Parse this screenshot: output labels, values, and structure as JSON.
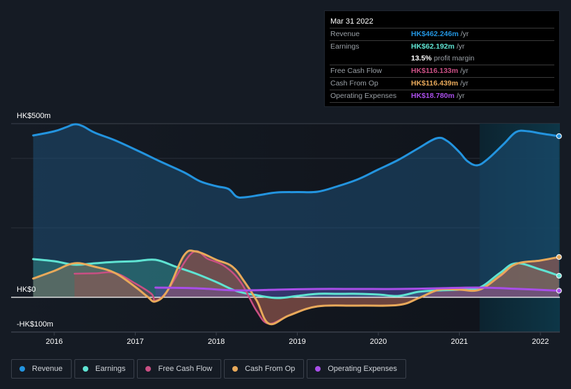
{
  "chart_data": {
    "type": "area",
    "title": "",
    "currency_prefix": "HK$",
    "x_unit": "year",
    "xlim": [
      2015.74,
      2022.25
    ],
    "ylim": [
      -100,
      500
    ],
    "y_ticks": [
      {
        "value": 500,
        "label": "HK$500m"
      },
      {
        "value": 0,
        "label": "HK$0"
      },
      {
        "value": -100,
        "label": "-HK$100m"
      }
    ],
    "gridlines": [
      500,
      400,
      200
    ],
    "x_ticks": [
      {
        "value": 2016,
        "label": "2016"
      },
      {
        "value": 2017,
        "label": "2017"
      },
      {
        "value": 2018,
        "label": "2018"
      },
      {
        "value": 2019,
        "label": "2019"
      },
      {
        "value": 2020,
        "label": "2020"
      },
      {
        "value": 2021,
        "label": "2021"
      },
      {
        "value": 2022,
        "label": "2022"
      }
    ],
    "highlight_range": [
      2021.25,
      2022.25
    ],
    "series": [
      {
        "name": "Revenue",
        "color": "#2394df",
        "points": [
          [
            2015.74,
            466
          ],
          [
            2016.0,
            478
          ],
          [
            2016.15,
            490
          ],
          [
            2016.25,
            498
          ],
          [
            2016.35,
            493
          ],
          [
            2016.5,
            474
          ],
          [
            2016.75,
            452
          ],
          [
            2017.05,
            420
          ],
          [
            2017.3,
            392
          ],
          [
            2017.6,
            360
          ],
          [
            2017.8,
            334
          ],
          [
            2018.0,
            320
          ],
          [
            2018.15,
            312
          ],
          [
            2018.25,
            290
          ],
          [
            2018.35,
            288
          ],
          [
            2018.55,
            295
          ],
          [
            2018.75,
            302
          ],
          [
            2019.0,
            303
          ],
          [
            2019.25,
            304
          ],
          [
            2019.5,
            320
          ],
          [
            2019.75,
            340
          ],
          [
            2020.0,
            368
          ],
          [
            2020.25,
            396
          ],
          [
            2020.5,
            430
          ],
          [
            2020.72,
            458
          ],
          [
            2020.85,
            450
          ],
          [
            2021.0,
            418
          ],
          [
            2021.1,
            392
          ],
          [
            2021.22,
            380
          ],
          [
            2021.35,
            398
          ],
          [
            2021.55,
            442
          ],
          [
            2021.7,
            476
          ],
          [
            2021.85,
            478
          ],
          [
            2022.0,
            472
          ],
          [
            2022.23,
            464
          ]
        ]
      },
      {
        "name": "Earnings",
        "color": "#5fe3d2",
        "points": [
          [
            2015.74,
            110
          ],
          [
            2016.0,
            104
          ],
          [
            2016.25,
            94
          ],
          [
            2016.5,
            98
          ],
          [
            2016.75,
            102
          ],
          [
            2017.0,
            104
          ],
          [
            2017.25,
            108
          ],
          [
            2017.5,
            88
          ],
          [
            2017.75,
            68
          ],
          [
            2018.0,
            44
          ],
          [
            2018.25,
            18
          ],
          [
            2018.5,
            6
          ],
          [
            2018.75,
            -2
          ],
          [
            2019.0,
            4
          ],
          [
            2019.25,
            10
          ],
          [
            2019.5,
            10
          ],
          [
            2019.75,
            10
          ],
          [
            2020.0,
            8
          ],
          [
            2020.25,
            4
          ],
          [
            2020.5,
            16
          ],
          [
            2020.75,
            20
          ],
          [
            2021.0,
            22
          ],
          [
            2021.25,
            28
          ],
          [
            2021.5,
            70
          ],
          [
            2021.7,
            98
          ],
          [
            2022.0,
            80
          ],
          [
            2022.23,
            62
          ]
        ]
      },
      {
        "name": "Free Cash Flow",
        "color": "#c94f83",
        "points": [
          [
            2016.25,
            68
          ],
          [
            2016.5,
            69
          ],
          [
            2016.75,
            70
          ],
          [
            2017.0,
            40
          ],
          [
            2017.2,
            10
          ],
          [
            2017.25,
            -10
          ],
          [
            2017.4,
            20
          ],
          [
            2017.7,
            128
          ],
          [
            2017.9,
            110
          ],
          [
            2018.1,
            90
          ],
          [
            2018.3,
            44
          ],
          [
            2018.5,
            -40
          ],
          [
            2018.65,
            -76
          ],
          [
            2018.9,
            -52
          ],
          [
            2019.25,
            -26
          ],
          [
            2019.75,
            -24
          ],
          [
            2020.25,
            -22
          ],
          [
            2020.5,
            -2
          ],
          [
            2020.75,
            22
          ],
          [
            2021.0,
            22
          ],
          [
            2021.25,
            22
          ],
          [
            2021.5,
            60
          ],
          [
            2021.7,
            96
          ],
          [
            2022.0,
            106
          ],
          [
            2022.23,
            116
          ]
        ]
      },
      {
        "name": "Cash From Op",
        "color": "#e8a95a",
        "points": [
          [
            2015.74,
            54
          ],
          [
            2016.0,
            76
          ],
          [
            2016.25,
            98
          ],
          [
            2016.5,
            88
          ],
          [
            2016.75,
            70
          ],
          [
            2017.0,
            30
          ],
          [
            2017.15,
            2
          ],
          [
            2017.25,
            -12
          ],
          [
            2017.4,
            20
          ],
          [
            2017.6,
            120
          ],
          [
            2017.75,
            132
          ],
          [
            2018.0,
            108
          ],
          [
            2018.2,
            88
          ],
          [
            2018.35,
            44
          ],
          [
            2018.5,
            -10
          ],
          [
            2018.65,
            -76
          ],
          [
            2018.9,
            -52
          ],
          [
            2019.25,
            -26
          ],
          [
            2019.75,
            -24
          ],
          [
            2020.25,
            -22
          ],
          [
            2020.5,
            -2
          ],
          [
            2020.75,
            22
          ],
          [
            2021.0,
            22
          ],
          [
            2021.25,
            22
          ],
          [
            2021.5,
            62
          ],
          [
            2021.7,
            96
          ],
          [
            2022.0,
            106
          ],
          [
            2022.23,
            116
          ]
        ]
      },
      {
        "name": "Operating Expenses",
        "color": "#a84ee8",
        "points": [
          [
            2017.25,
            28
          ],
          [
            2017.75,
            26
          ],
          [
            2018.25,
            20
          ],
          [
            2018.75,
            22
          ],
          [
            2019.25,
            24
          ],
          [
            2019.75,
            24
          ],
          [
            2020.25,
            24
          ],
          [
            2020.75,
            26
          ],
          [
            2021.25,
            28
          ],
          [
            2021.75,
            24
          ],
          [
            2022.23,
            19
          ]
        ]
      }
    ],
    "legend_position": "bottom-left"
  },
  "tooltip": {
    "date": "Mar 31 2022",
    "rows": [
      {
        "label": "Revenue",
        "value": "HK$462.246m",
        "unit": "/yr",
        "color": "#2394df"
      },
      {
        "label": "Earnings",
        "value": "HK$62.192m",
        "unit": "/yr",
        "color": "#5fe3d2"
      },
      {
        "label": "",
        "value": "13.5%",
        "unit": "profit margin",
        "color": "#ffffff"
      },
      {
        "label": "Free Cash Flow",
        "value": "HK$116.133m",
        "unit": "/yr",
        "color": "#c94f83"
      },
      {
        "label": "Cash From Op",
        "value": "HK$116.439m",
        "unit": "/yr",
        "color": "#e8a95a"
      },
      {
        "label": "Operating Expenses",
        "value": "HK$18.780m",
        "unit": "/yr",
        "color": "#a84ee8"
      }
    ]
  },
  "legend": [
    {
      "label": "Revenue",
      "color": "#2394df"
    },
    {
      "label": "Earnings",
      "color": "#5fe3d2"
    },
    {
      "label": "Free Cash Flow",
      "color": "#c94f83"
    },
    {
      "label": "Cash From Op",
      "color": "#e8a95a"
    },
    {
      "label": "Operating Expenses",
      "color": "#a84ee8"
    }
  ]
}
